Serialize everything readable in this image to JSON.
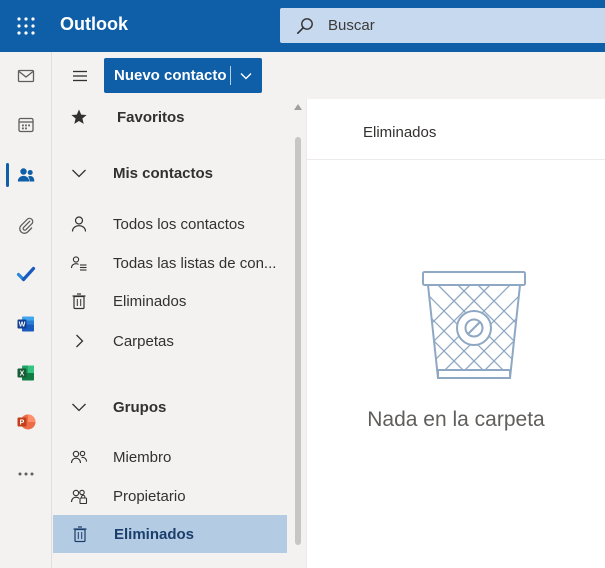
{
  "app": {
    "title": "Outlook"
  },
  "search": {
    "placeholder": "Buscar"
  },
  "rail": {
    "items": [
      "mail",
      "calendar",
      "people",
      "attachments",
      "todo",
      "word",
      "excel",
      "powerpoint",
      "more"
    ],
    "active": "people"
  },
  "toolbar": {
    "new_contact_label": "Nuevo contacto"
  },
  "nav": {
    "favorites": "Favoritos",
    "my_contacts": {
      "header": "Mis contactos",
      "items": [
        "Todos los contactos",
        "Todas las listas de con...",
        "Eliminados",
        "Carpetas"
      ]
    },
    "groups": {
      "header": "Grupos",
      "items": [
        "Miembro",
        "Propietario",
        "Eliminados"
      ]
    },
    "selected": "Eliminados"
  },
  "content": {
    "header_title": "Eliminados",
    "empty_message": "Nada en la carpeta"
  },
  "colors": {
    "brand": "#0f5ea8",
    "search_bg": "#c7d9ef",
    "selected_bg": "#b3cbe3",
    "illustration": "#8ea8c4"
  }
}
